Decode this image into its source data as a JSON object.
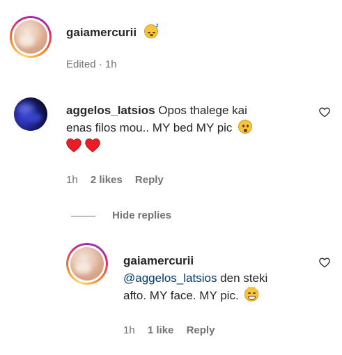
{
  "top_comment": {
    "username": "gaiamercurii",
    "emoji": "sleeping-face-emoji",
    "status": "Edited · 1h"
  },
  "comment": {
    "username": "aggelos_latsios",
    "text_line1": "Opos thalege kai",
    "text_line2": "enas filos mou.. MY bed MY pic",
    "time": "1h",
    "likes": "2 likes",
    "reply": "Reply"
  },
  "hide_replies": "Hide replies",
  "reply_comment": {
    "username": "gaiamercurii",
    "mention": "@aggelos_latsios",
    "text_after_mention": " den steki",
    "text_line2": "afto. MY face. MY pic.",
    "time": "1h",
    "likes": "1 like",
    "reply": "Reply"
  },
  "colors": {
    "text": "#262626",
    "meta": "#737373",
    "mention": "#00376b",
    "heart": "#ed1c24"
  }
}
